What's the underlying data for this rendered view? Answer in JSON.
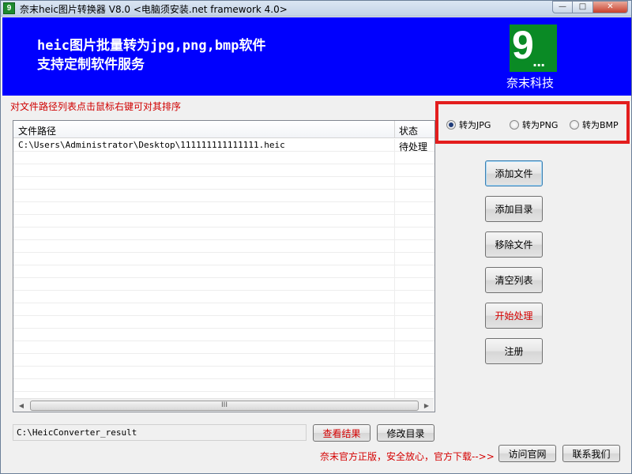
{
  "window": {
    "title": "奈末heic图片转换器 V8.0 <电脑须安装.net framework 4.0>",
    "icon_label": "9",
    "controls": {
      "minimize": "—",
      "maximize": "□",
      "close": "✕"
    }
  },
  "banner": {
    "line1": "heic图片批量转为jpg,png,bmp软件",
    "line2": "支持定制软件服务",
    "logo_digit": "9",
    "logo_dots": "...",
    "company": "奈末科技"
  },
  "hint": "对文件路径列表点击鼠标右键可对其排序",
  "file_list": {
    "columns": [
      "文件路径",
      "状态"
    ],
    "rows": [
      {
        "path": "C:\\Users\\Administrator\\Desktop\\111111111111111.heic",
        "status": "待处理"
      }
    ],
    "scroll_grip": "III"
  },
  "format_options": [
    {
      "label": "转为JPG",
      "selected": true
    },
    {
      "label": "转为PNG",
      "selected": false
    },
    {
      "label": "转为BMP",
      "selected": false
    }
  ],
  "buttons": {
    "add_file": "添加文件",
    "add_dir": "添加目录",
    "remove_file": "移除文件",
    "clear_list": "清空列表",
    "start": "开始处理",
    "register": "注册",
    "view_result": "查看结果",
    "change_dir": "修改目录",
    "visit_site": "访问官网",
    "contact": "联系我们"
  },
  "output": {
    "path": "C:\\HeicConverter_result"
  },
  "promo": "奈末官方正版，安全放心，官方下载-->>",
  "colors": {
    "banner": "#0000fe",
    "logo_green": "#0a8a25",
    "accent_red": "#d40000",
    "highlight_border": "#e31d1d"
  }
}
